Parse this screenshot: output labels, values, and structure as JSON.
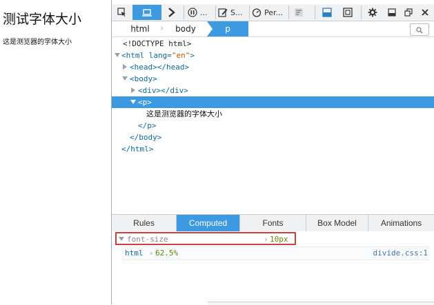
{
  "page": {
    "heading": "测试字体大小",
    "paragraph": "这是测览器的字体大小"
  },
  "toolbar": {
    "tools": [
      {
        "name": "pick-element",
        "icon": "cursor-select-icon"
      },
      {
        "name": "inspector",
        "icon": "responsive-layout-icon"
      },
      {
        "name": "console",
        "icon": "console-chevron-icon"
      },
      {
        "name": "debugger",
        "icon": "pause-icon",
        "label": "..."
      },
      {
        "name": "style-editor",
        "icon": "edit-icon",
        "label": "S..."
      },
      {
        "name": "performance",
        "icon": "stopwatch-icon",
        "label": "Per..."
      },
      {
        "name": "network",
        "icon": "network-icon"
      },
      {
        "name": "split-console",
        "icon": "split-console-icon"
      },
      {
        "name": "frames",
        "icon": "frame-icon"
      },
      {
        "name": "settings",
        "icon": "gear-icon"
      },
      {
        "name": "dock",
        "icon": "dock-bottom-icon"
      },
      {
        "name": "undock",
        "icon": "undock-icon"
      },
      {
        "name": "close",
        "icon": "close-icon"
      }
    ]
  },
  "breadcrumb": {
    "items": [
      "html",
      "body",
      "p"
    ],
    "search_icon": "search-icon"
  },
  "markup": {
    "doctype": "<!DOCTYPE html>",
    "html_open_tag": "<html",
    "html_attr": " lang=",
    "html_attr_value": "\"en\"",
    "html_close_bracket": ">",
    "head": "<head></head>",
    "body_open": "<body>",
    "div": "<div></div>",
    "p_open": "<p>",
    "p_text": "这是测览器的字体大小",
    "p_close": "</p>",
    "body_close": "</body>",
    "html_close": "</html>"
  },
  "side_panel": {
    "tabs": [
      "Rules",
      "Computed",
      "Fonts",
      "Box Model",
      "Animations"
    ],
    "active_tab": "Computed",
    "property": {
      "name": "font-size",
      "value": "10px"
    },
    "match": {
      "selector": "html",
      "value": "62.5%",
      "source": "divide.css:1"
    }
  },
  "colors": {
    "accent": "#3d9ae0",
    "highlight_border": "#d03b3b",
    "tag": "#0c6aa1",
    "attr_value": "#b85b00",
    "value_green": "#5a8a00"
  }
}
